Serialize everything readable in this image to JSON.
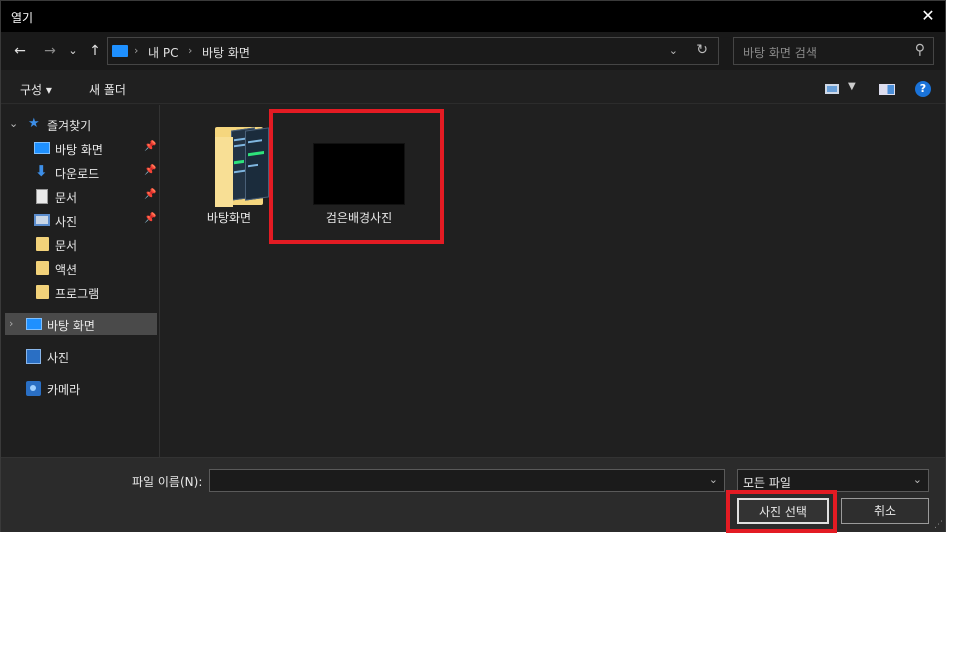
{
  "window": {
    "title": "열기",
    "close_glyph": "✕"
  },
  "nav": {
    "back": "←",
    "forward": "→",
    "recent": "⌄",
    "up": "↑",
    "breadcrumb": [
      "내 PC",
      "바탕 화면"
    ],
    "sep": "›",
    "dropdown": "⌄",
    "refresh": "↻",
    "search_placeholder": "바탕 화면 검색",
    "search_icon": "⚲"
  },
  "toolbar": {
    "organize": "구성 ▾",
    "new_folder": "새 폴더",
    "help": "?",
    "view_dd": "▼"
  },
  "sidebar": {
    "expand": "⌄",
    "quick_access": "즐겨찾기",
    "pin": "📌",
    "items": [
      {
        "label": "바탕 화면",
        "icon": "desktop-icon",
        "pinned": true
      },
      {
        "label": "다운로드",
        "icon": "download-icon",
        "pinned": true
      },
      {
        "label": "문서",
        "icon": "document-icon",
        "pinned": true
      },
      {
        "label": "사진",
        "icon": "pictures-icon",
        "pinned": true
      },
      {
        "label": "문서",
        "icon": "folder-icon",
        "pinned": false
      },
      {
        "label": "액션",
        "icon": "folder-icon",
        "pinned": false
      },
      {
        "label": "프로그램",
        "icon": "folder-icon",
        "pinned": false
      }
    ],
    "selected": "바탕 화면",
    "collapse": "›",
    "others": [
      "사진",
      "카메라"
    ]
  },
  "files": [
    {
      "name": "바탕화면",
      "type": "folder"
    },
    {
      "name": "검은배경사진",
      "type": "image"
    }
  ],
  "footer": {
    "filename_label": "파일 이름(N):",
    "filename_value": "",
    "filetype": "모든 파일",
    "dd": "⌄",
    "ok": "사진 선택",
    "cancel": "취소",
    "grip": "⋰"
  },
  "colors": {
    "highlight": "#e31b23",
    "accent": "#1e90ff"
  }
}
